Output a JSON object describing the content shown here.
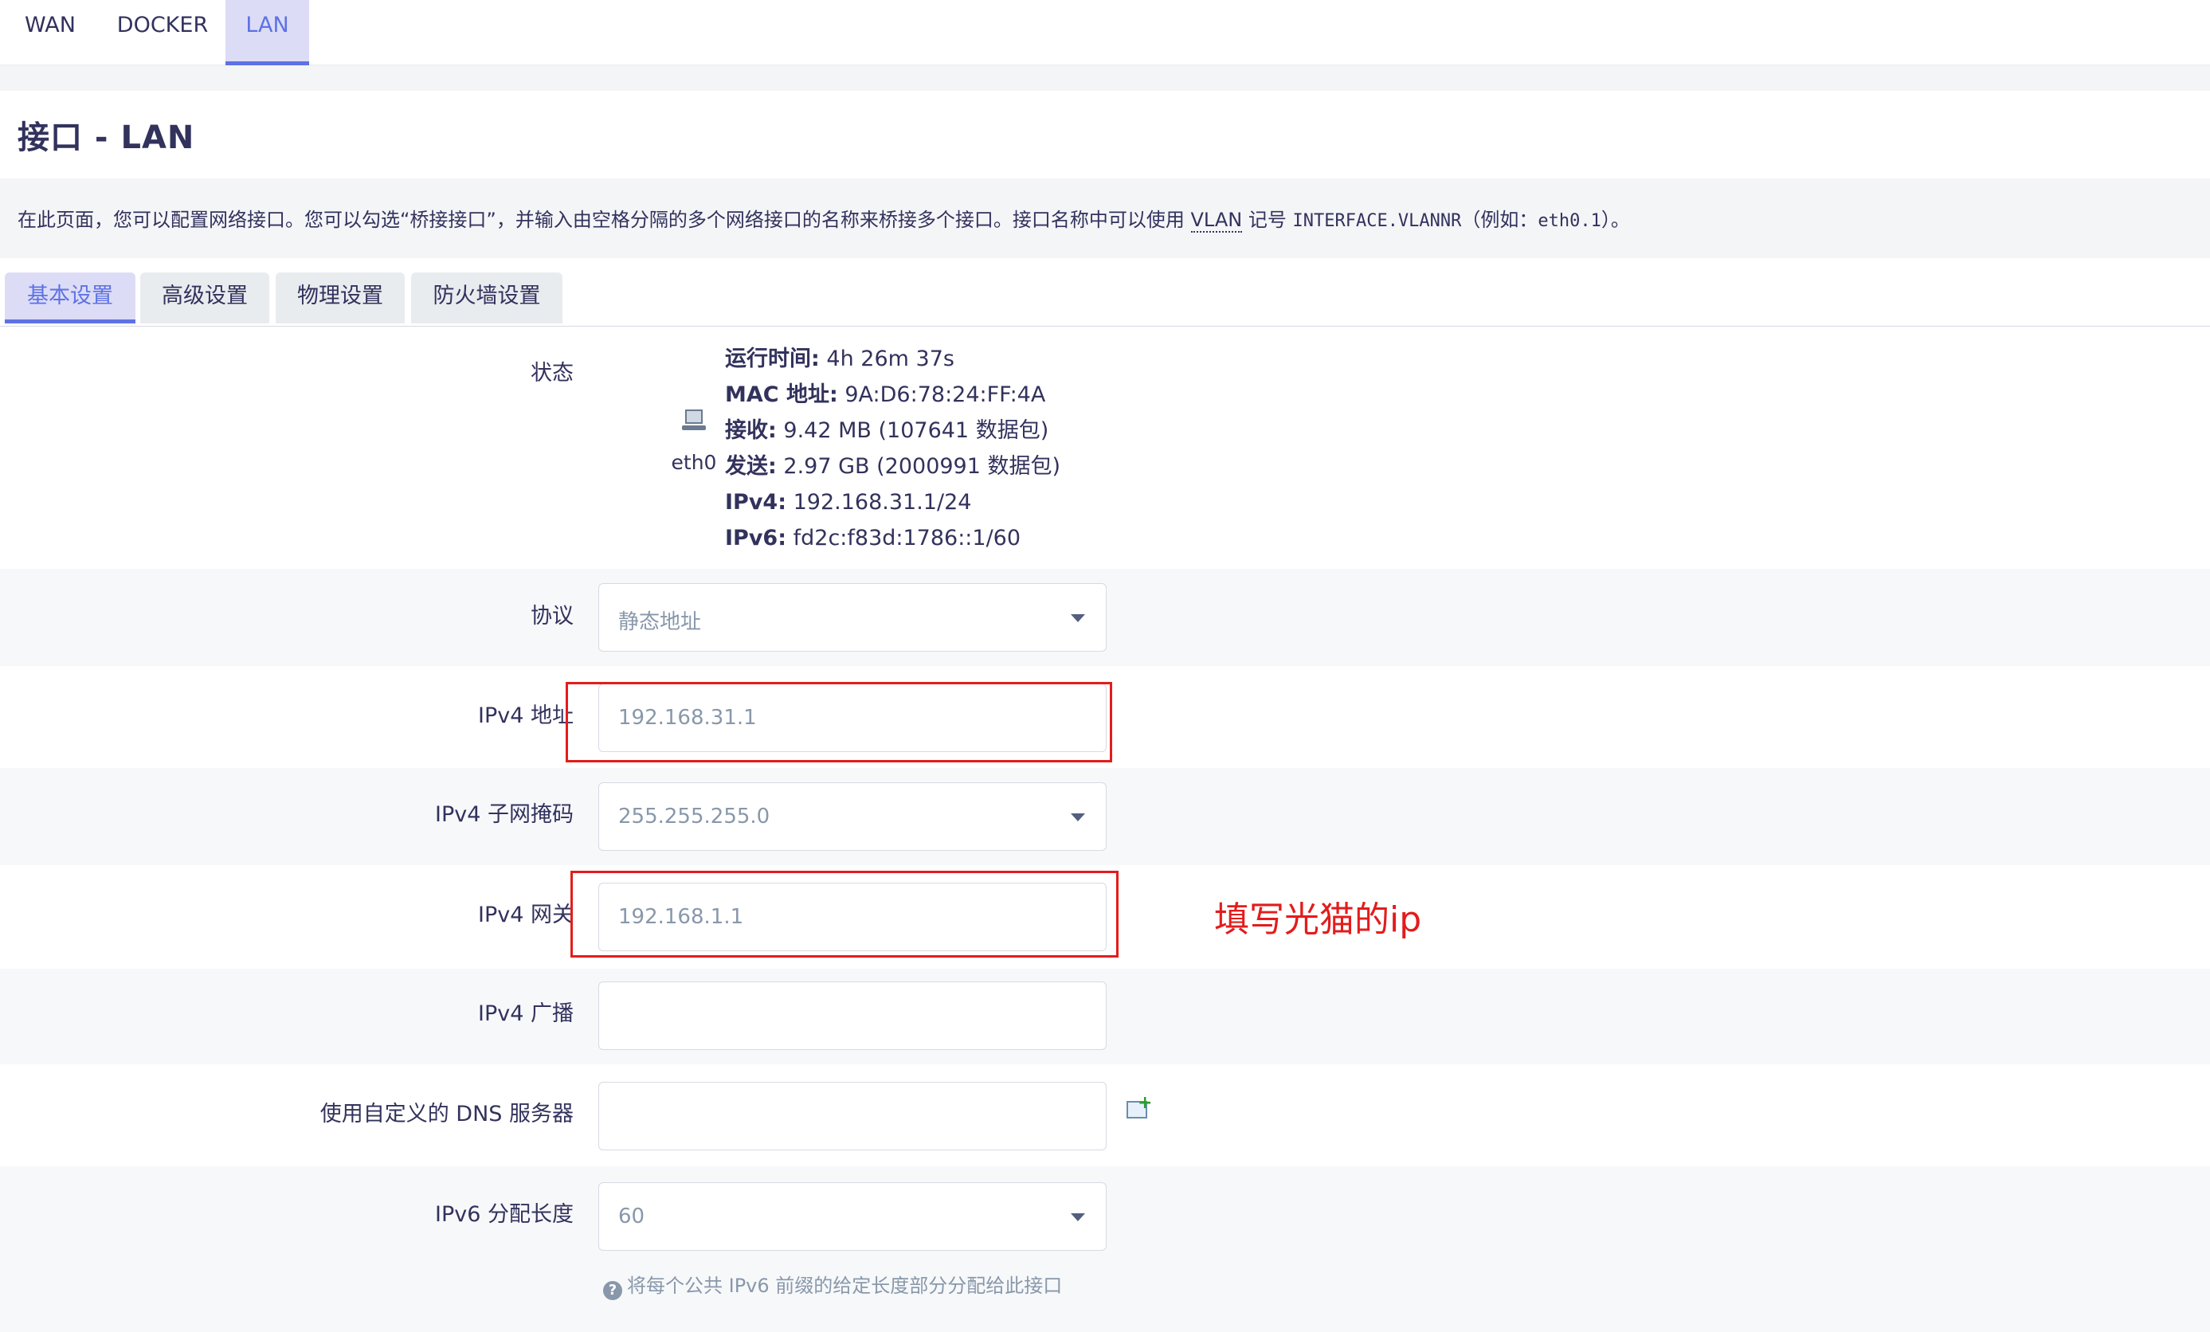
{
  "top_tabs": [
    "WAN",
    "DOCKER",
    "LAN"
  ],
  "page_title": "接口 - LAN",
  "description": {
    "before_link": "在此页面，您可以配置网络接口。您可以勾选“桥接接口”，并输入由空格分隔的多个网络接口的名称来桥接多个接口。接口名称中可以使用 ",
    "link": "VLAN",
    "middle": " 记号 ",
    "code1": "INTERFACE.VLANNR",
    "example_prefix": "（例如：",
    "code2": "eth0.1",
    "suffix": "）。"
  },
  "section_tabs": [
    "基本设置",
    "高级设置",
    "物理设置",
    "防火墙设置"
  ],
  "status": {
    "label": "状态",
    "device": "eth0",
    "device_icon": "ethernet-port-icon",
    "uptime_label": "运行时间:",
    "uptime": "4h 26m 37s",
    "mac_label": "MAC 地址:",
    "mac": "9A:D6:78:24:FF:4A",
    "rx_label": "接收:",
    "rx": "9.42 MB (107641 数据包)",
    "tx_label": "发送:",
    "tx": "2.97 GB (2000991 数据包)",
    "ipv4_label": "IPv4:",
    "ipv4": "192.168.31.1/24",
    "ipv6_label": "IPv6:",
    "ipv6": "fd2c:f83d:1786::1/60"
  },
  "form": {
    "protocol": {
      "label": "协议",
      "value": "静态地址"
    },
    "ipv4_addr": {
      "label": "IPv4 地址",
      "value": "192.168.31.1"
    },
    "ipv4_netmask": {
      "label": "IPv4 子网掩码",
      "value": "255.255.255.0"
    },
    "ipv4_gateway": {
      "label": "IPv4 网关",
      "value": "192.168.1.1"
    },
    "ipv4_broadcast": {
      "label": "IPv4 广播",
      "value": ""
    },
    "dns": {
      "label": "使用自定义的 DNS 服务器",
      "value": "",
      "add_icon": "add-entry-icon"
    },
    "ipv6_assign": {
      "label": "IPv6 分配长度",
      "value": "60",
      "help": "将每个公共 IPv6 前缀的给定长度部分分配给此接口",
      "help_icon": "question-circle-icon"
    }
  },
  "annotation": "填写光猫的ip",
  "colors": {
    "accent": "#5e72e4",
    "active_tab_bg": "#dcdcf7",
    "annotation_red": "#e31c1c",
    "text": "#32325d",
    "muted": "#8898aa"
  }
}
